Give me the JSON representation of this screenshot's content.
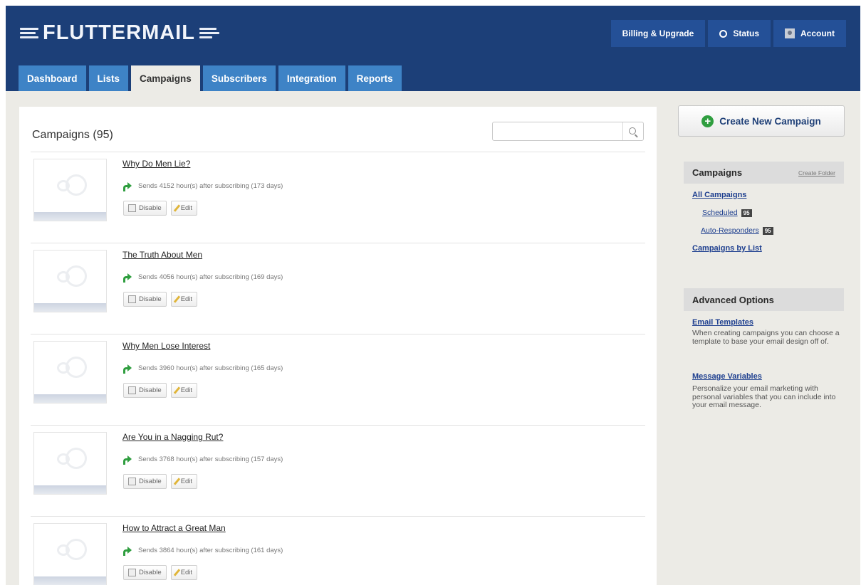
{
  "app": {
    "logo_text": "FLUTTERMAIL",
    "colors": {
      "header": "#1c3f78",
      "tab": "#3e83c6",
      "accent_green": "#2f9e3f",
      "link": "#1e3f8f"
    }
  },
  "topnav": {
    "billing": "Billing & Upgrade",
    "status": "Status",
    "account": "Account"
  },
  "tabs": [
    {
      "label": "Dashboard"
    },
    {
      "label": "Lists"
    },
    {
      "label": "Campaigns",
      "active": true
    },
    {
      "label": "Subscribers"
    },
    {
      "label": "Integration"
    },
    {
      "label": "Reports"
    }
  ],
  "main": {
    "title": "Campaigns (95)",
    "search_placeholder": "",
    "disable_label": "Disable",
    "edit_label": "Edit",
    "campaigns": [
      {
        "title": "Why Do Men Lie?",
        "info": "Sends 4152 hour(s) after subscribing (173 days)"
      },
      {
        "title": "The Truth About Men",
        "info": "Sends 4056 hour(s) after subscribing (169 days)"
      },
      {
        "title": "Why Men Lose Interest",
        "info": "Sends 3960 hour(s) after subscribing (165 days)"
      },
      {
        "title": "Are You in a Nagging Rut?",
        "info": "Sends 3768 hour(s) after subscribing (157 days)"
      },
      {
        "title": "How to Attract a Great Man",
        "info": "Sends 3864 hour(s) after subscribing (161 days)"
      }
    ]
  },
  "sidebar": {
    "create_label": "Create New Campaign",
    "campaigns_heading": "Campaigns",
    "create_folder": "Create Folder",
    "all_campaigns": "All Campaigns",
    "scheduled": "Scheduled",
    "scheduled_count": "95",
    "auto_responders": "Auto-Responders",
    "auto_responders_count": "95",
    "by_list": "Campaigns by List",
    "advanced_heading": "Advanced Options",
    "email_templates": "Email Templates",
    "email_templates_desc": "When creating campaigns you can choose a template to base your email design off of.",
    "message_variables": "Message Variables",
    "message_variables_desc": "Personalize your email marketing with personal variables that you can include into your email message."
  }
}
